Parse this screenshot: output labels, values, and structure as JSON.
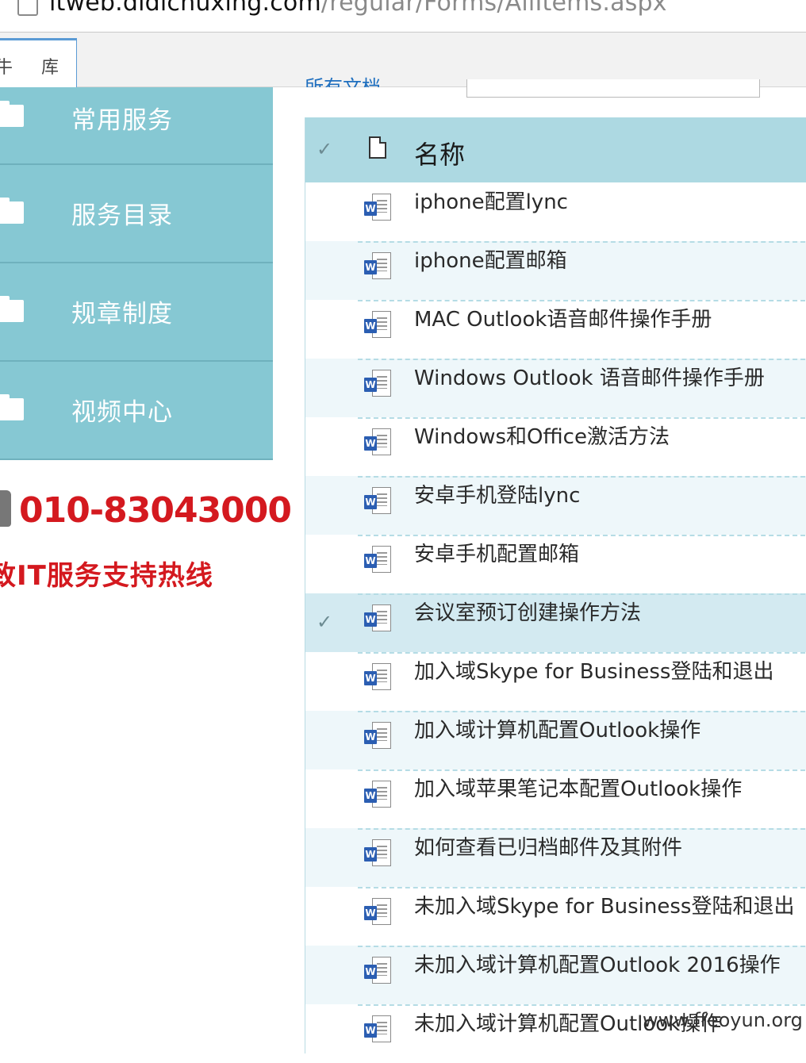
{
  "browser": {
    "url_host": "itweb.didichuxing.com",
    "url_path": "/regular/Forms/AllItems.aspx",
    "tab_fragment_left": "牛",
    "tab_label": "库"
  },
  "leftnav": {
    "items": [
      {
        "label": "常用服务",
        "icon": "folder-icon"
      },
      {
        "label": "服务目录",
        "icon": "folder-icon"
      },
      {
        "label": "规章制度",
        "icon": "folder-icon"
      },
      {
        "label": "视频中心",
        "icon": "folder-icon"
      }
    ]
  },
  "hotline": {
    "number": "010-83043000",
    "tagline": "致IT服务支持热线",
    "color": "#d4191f"
  },
  "toolbar": {
    "partial_link": "所有文档"
  },
  "doclist": {
    "header_name": "名称",
    "header_accent": "#add9e2",
    "rows": [
      {
        "title": "iphone配置lync"
      },
      {
        "title": "iphone配置邮箱"
      },
      {
        "title": "MAC Outlook语音邮件操作手册"
      },
      {
        "title": "Windows Outlook 语音邮件操作手册"
      },
      {
        "title": "Windows和Office激活方法"
      },
      {
        "title": "安卓手机登陆lync"
      },
      {
        "title": "安卓手机配置邮箱"
      },
      {
        "title": "会议室预订创建操作方法",
        "selected": true
      },
      {
        "title": "加入域Skype for Business登陆和退出"
      },
      {
        "title": "加入域计算机配置Outlook操作"
      },
      {
        "title": "加入域苹果笔记本配置Outlook操作"
      },
      {
        "title": "如何查看已归档邮件及其附件"
      },
      {
        "title": "未加入域Skype for Business登陆和退出"
      },
      {
        "title": "未加入域计算机配置Outlook 2016操作"
      },
      {
        "title": "未加入域计算机配置Outlook操作"
      }
    ],
    "file_icon": "word-doc-icon",
    "badge_letter": "W",
    "check_glyph": "✓"
  },
  "watermark": "www.ffeoyun.org"
}
